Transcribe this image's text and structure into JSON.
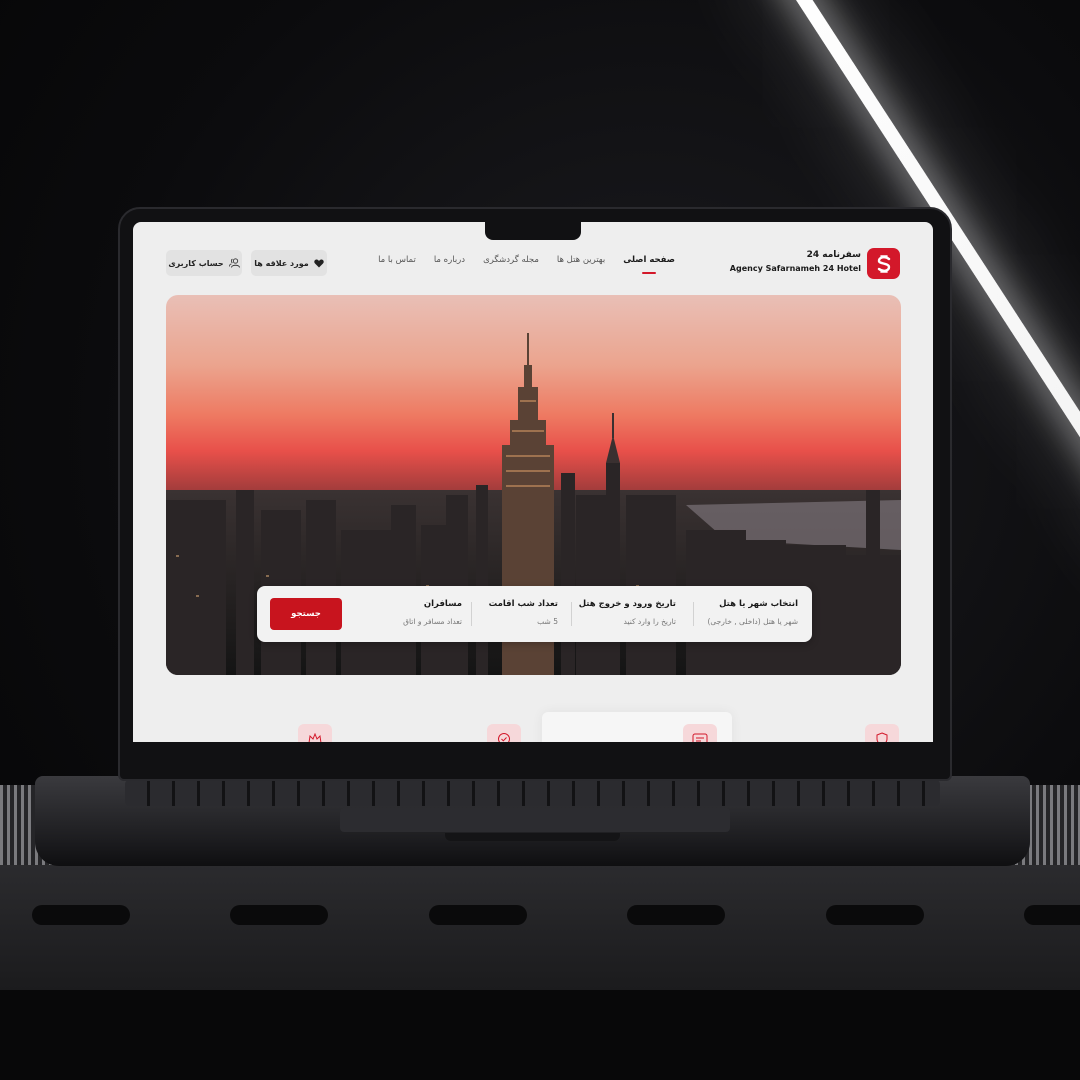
{
  "brand": {
    "name_fa": "سفرنامه 24",
    "name_en": "Agency Safarnameh 24 Hotel",
    "accent_color": "#d3182a",
    "logo_icon": "brand-s-logo-icon"
  },
  "nav": {
    "items": [
      {
        "label": "صفحه اصلی",
        "active": true
      },
      {
        "label": "بهترین هتل ها",
        "active": false
      },
      {
        "label": "مجله گردشگری",
        "active": false
      },
      {
        "label": "درباره ما",
        "active": false
      },
      {
        "label": "تماس با ما",
        "active": false
      }
    ]
  },
  "actions": {
    "favorites_label": "مورد علاقه ها",
    "favorites_icon": "heart-icon",
    "account_label": "حساب کاربری",
    "account_icon": "users-icon"
  },
  "search": {
    "fields": [
      {
        "label": "انتخاب شهر یا هتل",
        "hint": "شهر یا هتل (داخلی , خارجی)"
      },
      {
        "label": "تاریخ ورود و خروج هتل",
        "hint": "تاریخ را وارد کنید"
      },
      {
        "label": "تعداد شب اقامت",
        "hint": "5 شب"
      },
      {
        "label": "مسافران",
        "hint": "تعداد مسافر و اتاق"
      }
    ],
    "button_label": "جستجو"
  },
  "features": {
    "icons": [
      "crown-icon",
      "check-badge-icon",
      "message-card-icon",
      "shield-icon"
    ]
  }
}
